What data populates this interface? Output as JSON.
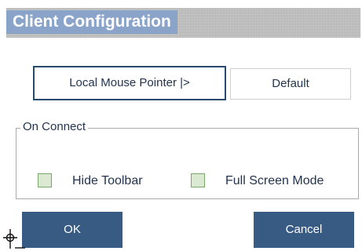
{
  "dialog": {
    "title": "Client Configuration"
  },
  "mouse_pointer": {
    "button_label": "Local Mouse Pointer |>",
    "value": "Default"
  },
  "on_connect": {
    "legend": "On Connect",
    "options": [
      {
        "label": "Hide Toolbar",
        "checked": false
      },
      {
        "label": "Full Screen Mode",
        "checked": false
      }
    ]
  },
  "actions": {
    "ok_label": "OK",
    "cancel_label": "Cancel"
  },
  "colors": {
    "title_background": "#8aa3c8",
    "button_background": "#385b84",
    "text": "#22344f",
    "checkbox_fill": "#dbe9d3",
    "checkbox_border": "#7aa76a"
  },
  "icons": {
    "cursor": "crosshair-cursor-icon"
  }
}
